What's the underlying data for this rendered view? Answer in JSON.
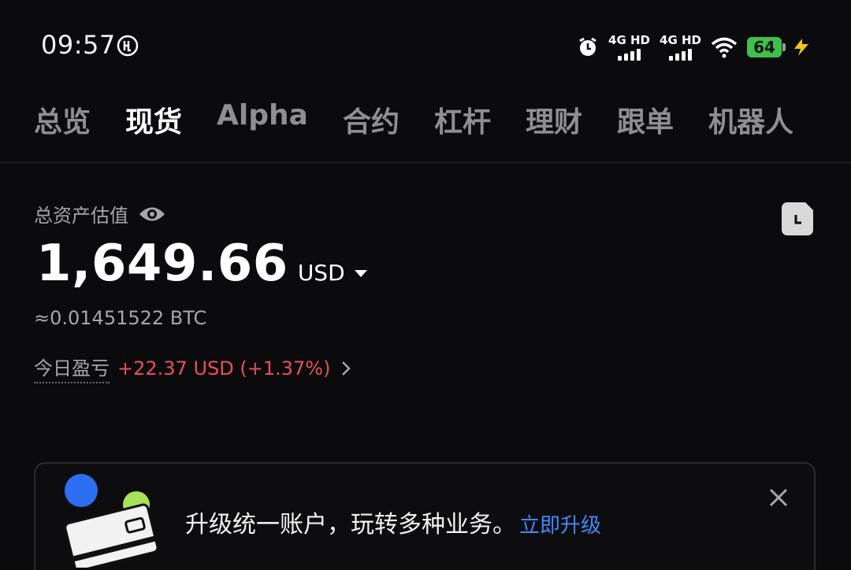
{
  "status_bar": {
    "time": "09:57",
    "signal_1": "4G HD",
    "signal_2": "4G HD",
    "battery": "64",
    "icons": [
      "app-notification-icon",
      "alarm-icon",
      "wifi-icon",
      "charging-bolt-icon"
    ]
  },
  "tabs": [
    {
      "label": "总览"
    },
    {
      "label": "现货",
      "active": true
    },
    {
      "label": "Alpha"
    },
    {
      "label": "合约"
    },
    {
      "label": "杠杆"
    },
    {
      "label": "理财"
    },
    {
      "label": "跟单"
    },
    {
      "label": "机器人"
    }
  ],
  "asset": {
    "label": "总资产估值",
    "balance": "1,649.66",
    "currency": "USD",
    "btc_equivalent": "≈0.01451522 BTC",
    "pnl_label": "今日盈亏",
    "pnl_value": "+22.37 USD (+1.37%)"
  },
  "banner": {
    "text": "升级统一账户，玩转多种业务。",
    "link": "立即升级"
  },
  "colors": {
    "background": "#0b0b0d",
    "accent_link": "#3d8bff",
    "pnl_red": "#e8505b",
    "battery_green": "#3fbf4b"
  }
}
